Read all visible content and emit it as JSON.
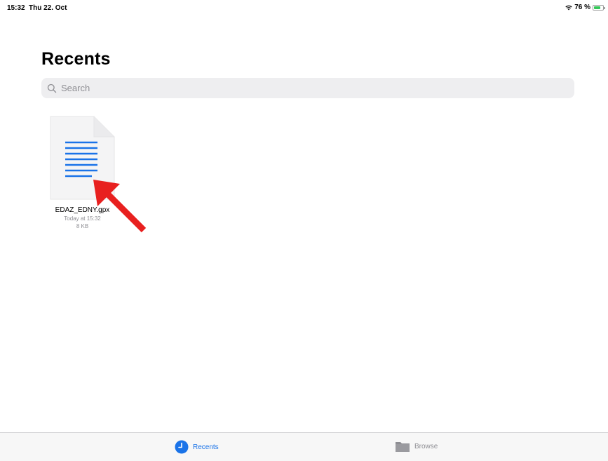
{
  "status_bar": {
    "time": "15:32",
    "date": "Thu 22. Oct",
    "battery_percent": "76 %",
    "battery_level": 0.76
  },
  "header": {
    "title": "Recents"
  },
  "search": {
    "placeholder": "Search"
  },
  "files": [
    {
      "name": "EDAZ_EDNY.gpx",
      "date": "Today at 15:32",
      "size": "8 KB",
      "icon": "document-lines-icon"
    }
  ],
  "tab_bar": {
    "tabs": [
      {
        "label": "Recents",
        "icon": "clock-icon",
        "active": true
      },
      {
        "label": "Browse",
        "icon": "folder-icon",
        "active": false
      }
    ]
  },
  "colors": {
    "accent": "#1a73e8",
    "annotation_arrow": "#e8201f",
    "battery": "#35c759"
  }
}
